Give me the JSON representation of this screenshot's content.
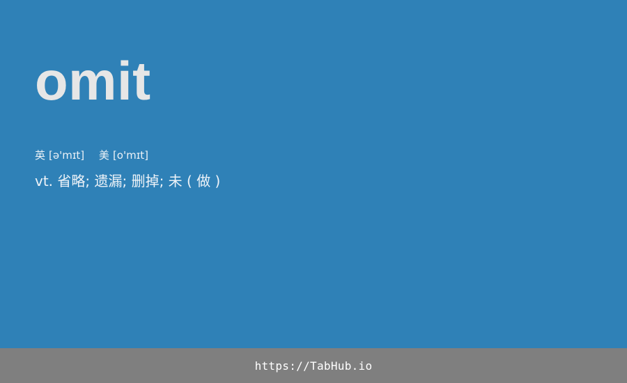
{
  "card": {
    "word": "omit",
    "phonetics": {
      "uk_label": "英",
      "uk_ipa": "[ə'mɪt]",
      "us_label": "美",
      "us_ipa": "[o'mɪt]"
    },
    "definition": "vt. 省略; 遗漏; 删掉; 未 ( 做 )"
  },
  "footer": {
    "url": "https://TabHub.io"
  },
  "colors": {
    "background": "#2f81b7",
    "footer_background": "#7f7f7f",
    "word_text": "#e6e6e6"
  }
}
